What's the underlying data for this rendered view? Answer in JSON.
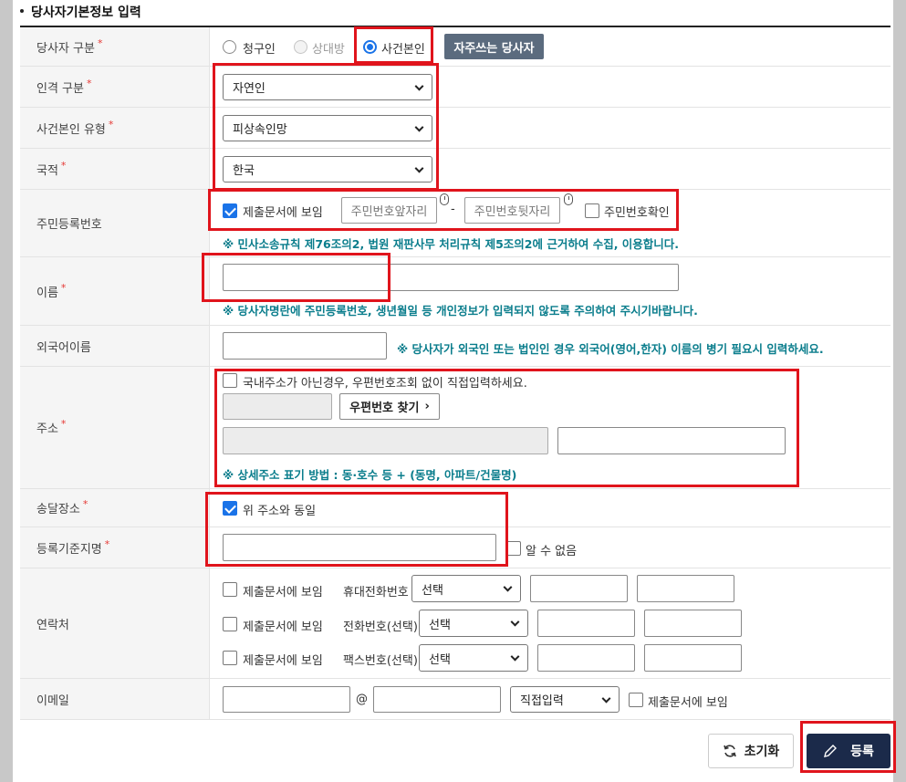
{
  "section_title": "당사자기본정보 입력",
  "rows": {
    "party_type": {
      "label": "당사자 구분",
      "options": [
        "청구인",
        "상대방",
        "사건본인"
      ],
      "selected": "사건본인",
      "frequent_button": "자주쓰는 당사자"
    },
    "person_type": {
      "label": "인격 구분",
      "value": "자연인"
    },
    "principal_type": {
      "label": "사건본인 유형",
      "value": "피상속인망"
    },
    "nationality": {
      "label": "국적",
      "value": "한국"
    },
    "rrn": {
      "label": "주민등록번호",
      "show_in_doc": "제출문서에 보임",
      "front_placeholder": "주민번호앞자리",
      "dash": "-",
      "back_placeholder": "주민번호뒷자리",
      "confirm": "주민번호확인",
      "note": "※ 민사소송규칙 제76조의2, 법원 재판사무 처리규칙 제5조의2에 근거하여 수집, 이용합니다."
    },
    "name": {
      "label": "이름",
      "note": "※ 당사자명란에 주민등록번호, 생년월일 등 개인정보가 입력되지 않도록 주의하여 주시기바랍니다."
    },
    "foreign_name": {
      "label": "외국어이름",
      "note": "※ 당사자가 외국인 또는 법인인 경우 외국어(영어,한자) 이름의 병기 필요시 입력하세요."
    },
    "address": {
      "label": "주소",
      "manual": "국내주소가 아닌경우, 우편번호조회 없이 직접입력하세요.",
      "zip_button": "우편번호 찾기",
      "note": "※ 상세주소 표기 방법 : 동·호수 등 + (동명, 아파트/건물명)"
    },
    "delivery": {
      "label": "송달장소",
      "same": "위 주소와 동일"
    },
    "reg_place": {
      "label": "등록기준지명",
      "unknown": "알 수 없음"
    },
    "contact": {
      "label": "연락처",
      "lines": [
        {
          "show": "제출문서에 보임",
          "type": "휴대전화번호",
          "select": "선택"
        },
        {
          "show": "제출문서에 보임",
          "type": "전화번호(선택)",
          "select": "선택"
        },
        {
          "show": "제출문서에 보임",
          "type": "팩스번호(선택)",
          "select": "선택"
        }
      ]
    },
    "email": {
      "label": "이메일",
      "at": "@",
      "domain_select": "직접입력",
      "show": "제출문서에 보임"
    }
  },
  "buttons": {
    "reset": "초기화",
    "submit": "등록"
  }
}
